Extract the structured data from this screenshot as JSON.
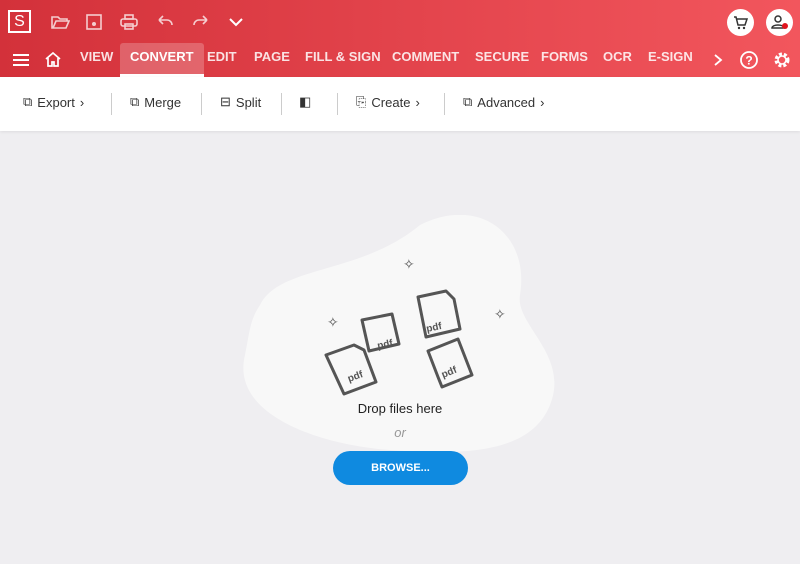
{
  "app": {
    "logo": "S"
  },
  "quick_access": [
    "open-folder-icon",
    "save-icon",
    "print-icon",
    "undo-icon",
    "redo-icon",
    "chevron-down-icon"
  ],
  "tabs": [
    {
      "label": "VIEW"
    },
    {
      "label": "CONVERT",
      "active": true
    },
    {
      "label": "EDIT"
    },
    {
      "label": "PAGE"
    },
    {
      "label": "FILL & SIGN"
    },
    {
      "label": "COMMENT"
    },
    {
      "label": "SECURE"
    },
    {
      "label": "FORMS"
    },
    {
      "label": "OCR"
    },
    {
      "label": "E-SIGN"
    }
  ],
  "toolbar": {
    "export": "Export",
    "merge": "Merge",
    "split": "Split",
    "create": "Create",
    "advanced": "Advanced"
  },
  "dropzone": {
    "text": "Drop files here",
    "or": "or",
    "browse": "BROWSE...",
    "file_label": "pdf"
  },
  "colors": {
    "header_start": "#d3313a",
    "header_end": "#f2565d",
    "browse": "#0f8ae0"
  }
}
